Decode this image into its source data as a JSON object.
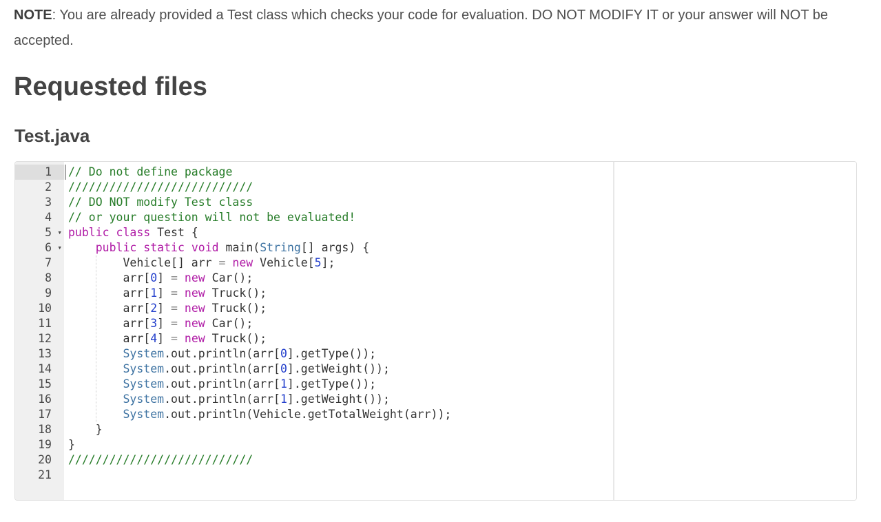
{
  "note": {
    "label": "NOTE",
    "text": ": You are already provided a Test class which checks your code for evaluation. DO NOT MODIFY IT or your answer will NOT be accepted."
  },
  "headings": {
    "page_title": "Requested files",
    "file_title": "Test.java"
  },
  "editor": {
    "language": "java",
    "fold_icon": "▾",
    "colors": {
      "comment": "#267c28",
      "keyword": "#b01ba6",
      "type": "#3e73a2",
      "number": "#2440cc",
      "operator": "#888888",
      "text": "#333333",
      "gutter_bg": "#f0f0f0",
      "gutter_active_bg": "#dedede",
      "gutter_text": "#494949"
    },
    "lines": [
      {
        "num": 1,
        "active": true,
        "tokens": [
          [
            "c",
            "// Do not define package"
          ]
        ]
      },
      {
        "num": 2,
        "tokens": [
          [
            "c",
            "///////////////////////////"
          ]
        ]
      },
      {
        "num": 3,
        "tokens": [
          [
            "c",
            "// DO NOT modify Test class"
          ]
        ]
      },
      {
        "num": 4,
        "tokens": [
          [
            "c",
            "// or your question will not be evaluated!"
          ]
        ]
      },
      {
        "num": 5,
        "fold": true,
        "tokens": [
          [
            "k",
            "public"
          ],
          [
            "p",
            " "
          ],
          [
            "k",
            "class"
          ],
          [
            "p",
            " Test {"
          ]
        ]
      },
      {
        "num": 6,
        "fold": true,
        "tokens": [
          [
            "p",
            "    "
          ],
          [
            "k",
            "public"
          ],
          [
            "p",
            " "
          ],
          [
            "k",
            "static"
          ],
          [
            "p",
            " "
          ],
          [
            "k",
            "void"
          ],
          [
            "p",
            " main("
          ],
          [
            "t",
            "String"
          ],
          [
            "p",
            "[] args) {"
          ]
        ]
      },
      {
        "num": 7,
        "tokens": [
          [
            "p",
            "        Vehicle[] arr "
          ],
          [
            "o",
            "="
          ],
          [
            "p",
            " "
          ],
          [
            "k",
            "new"
          ],
          [
            "p",
            " Vehicle["
          ],
          [
            "n",
            "5"
          ],
          [
            "p",
            "];"
          ]
        ]
      },
      {
        "num": 8,
        "tokens": [
          [
            "p",
            "        arr["
          ],
          [
            "n",
            "0"
          ],
          [
            "p",
            "] "
          ],
          [
            "o",
            "="
          ],
          [
            "p",
            " "
          ],
          [
            "k",
            "new"
          ],
          [
            "p",
            " Car();"
          ]
        ]
      },
      {
        "num": 9,
        "tokens": [
          [
            "p",
            "        arr["
          ],
          [
            "n",
            "1"
          ],
          [
            "p",
            "] "
          ],
          [
            "o",
            "="
          ],
          [
            "p",
            " "
          ],
          [
            "k",
            "new"
          ],
          [
            "p",
            " Truck();"
          ]
        ]
      },
      {
        "num": 10,
        "tokens": [
          [
            "p",
            "        arr["
          ],
          [
            "n",
            "2"
          ],
          [
            "p",
            "] "
          ],
          [
            "o",
            "="
          ],
          [
            "p",
            " "
          ],
          [
            "k",
            "new"
          ],
          [
            "p",
            " Truck();"
          ]
        ]
      },
      {
        "num": 11,
        "tokens": [
          [
            "p",
            "        arr["
          ],
          [
            "n",
            "3"
          ],
          [
            "p",
            "] "
          ],
          [
            "o",
            "="
          ],
          [
            "p",
            " "
          ],
          [
            "k",
            "new"
          ],
          [
            "p",
            " Car();"
          ]
        ]
      },
      {
        "num": 12,
        "tokens": [
          [
            "p",
            "        arr["
          ],
          [
            "n",
            "4"
          ],
          [
            "p",
            "] "
          ],
          [
            "o",
            "="
          ],
          [
            "p",
            " "
          ],
          [
            "k",
            "new"
          ],
          [
            "p",
            " Truck();"
          ]
        ]
      },
      {
        "num": 13,
        "tokens": [
          [
            "p",
            "        "
          ],
          [
            "t",
            "System"
          ],
          [
            "p",
            ".out.println(arr["
          ],
          [
            "n",
            "0"
          ],
          [
            "p",
            "].getType());"
          ]
        ]
      },
      {
        "num": 14,
        "tokens": [
          [
            "p",
            "        "
          ],
          [
            "t",
            "System"
          ],
          [
            "p",
            ".out.println(arr["
          ],
          [
            "n",
            "0"
          ],
          [
            "p",
            "].getWeight());"
          ]
        ]
      },
      {
        "num": 15,
        "tokens": [
          [
            "p",
            "        "
          ],
          [
            "t",
            "System"
          ],
          [
            "p",
            ".out.println(arr["
          ],
          [
            "n",
            "1"
          ],
          [
            "p",
            "].getType());"
          ]
        ]
      },
      {
        "num": 16,
        "tokens": [
          [
            "p",
            "        "
          ],
          [
            "t",
            "System"
          ],
          [
            "p",
            ".out.println(arr["
          ],
          [
            "n",
            "1"
          ],
          [
            "p",
            "].getWeight());"
          ]
        ]
      },
      {
        "num": 17,
        "tokens": [
          [
            "p",
            "        "
          ],
          [
            "t",
            "System"
          ],
          [
            "p",
            ".out.println(Vehicle.getTotalWeight(arr));"
          ]
        ]
      },
      {
        "num": 18,
        "tokens": [
          [
            "p",
            "    }"
          ]
        ]
      },
      {
        "num": 19,
        "tokens": [
          [
            "p",
            "}"
          ]
        ]
      },
      {
        "num": 20,
        "tokens": [
          [
            "c",
            "///////////////////////////"
          ]
        ]
      },
      {
        "num": 21,
        "tokens": []
      }
    ]
  }
}
